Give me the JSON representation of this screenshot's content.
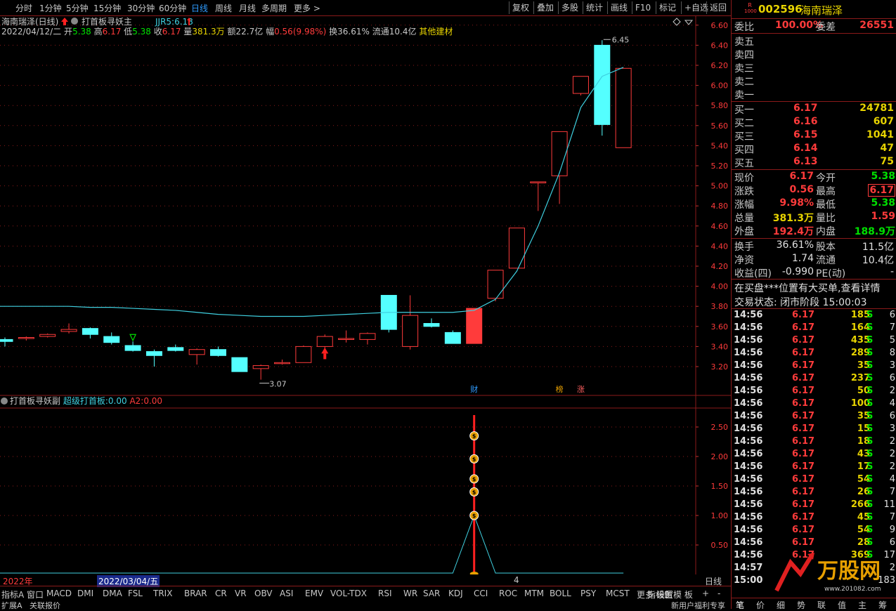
{
  "toolbar": {
    "periods": [
      "分时",
      "1分钟",
      "5分钟",
      "15分钟",
      "30分钟",
      "60分钟",
      "日线",
      "周线",
      "月线",
      "多周期",
      "更多 >"
    ],
    "active_period": "日线",
    "buttons": [
      "复权",
      "叠加",
      "多股",
      "统计",
      "画线",
      "F10",
      "标记",
      "+自选",
      "返回"
    ]
  },
  "info": {
    "title": "海南瑞泽(日线)",
    "indicator_main": "打首板寻妖主",
    "jjr_label": "JJR5:",
    "jjr_value": "6.18",
    "date": "2022/04/12/二",
    "open_label": "开",
    "open": "5.38",
    "high_label": "高",
    "high": "6.17",
    "low_label": "低",
    "low": "5.38",
    "close_label": "收",
    "close": "6.17",
    "volume_label": "量",
    "volume": "381.3万",
    "amount_label": "额",
    "amount": "22.7亿",
    "change_label": "幅",
    "change": "0.56(9.98%)",
    "turnover_label": "换",
    "turnover": "36.61%",
    "float_label": "流通",
    "float": "10.4亿",
    "sector": "其他建材"
  },
  "sub_panel": {
    "title": "打首板寻妖副",
    "s1_label": "超级打首板:",
    "s1_value": "0.00",
    "s2_label": "A2:",
    "s2_value": "0.00"
  },
  "annotations": {
    "high_mark": "6.45",
    "low_mark": "3.07",
    "tag_cai": "财",
    "tag_bang": "榜",
    "tag_zhang": "涨"
  },
  "timeaxis": {
    "year": "2022年",
    "cursor_date": "2022/03/04/五",
    "month4": "4",
    "daily_btn": "日线"
  },
  "bottom_tabs": [
    "指标A",
    "窗口",
    "MACD",
    "DMI",
    "DMA",
    "FSL",
    "TRIX",
    "BRAR",
    "CR",
    "VR",
    "OBV",
    "ASI",
    "EMV",
    "VOL-TDX",
    "RSI",
    "WR",
    "SAR",
    "KDJ",
    "CCI",
    "ROC",
    "MTM",
    "BOLL",
    "PSY",
    "MCST",
    "更多",
    "设置"
  ],
  "bottom_right": [
    "指标B",
    "模 板",
    "+",
    "-"
  ],
  "status": {
    "left1": "扩展A",
    "left2": "关联报价",
    "right": "新用户福利专享"
  },
  "quote": {
    "badge_top": "R",
    "badge_bottom": "1000",
    "code": "002596",
    "name": "海南瑞泽",
    "wb_label": "委比",
    "wb_value": "100.00%",
    "wc_label": "委差",
    "wc_value": "26551",
    "sells": [
      "卖五",
      "卖四",
      "卖三",
      "卖二",
      "卖一"
    ],
    "buys": [
      {
        "label": "买一",
        "price": "6.17",
        "vol": "24781"
      },
      {
        "label": "买二",
        "price": "6.16",
        "vol": "607"
      },
      {
        "label": "买三",
        "price": "6.15",
        "vol": "1041"
      },
      {
        "label": "买四",
        "price": "6.14",
        "vol": "47"
      },
      {
        "label": "买五",
        "price": "6.13",
        "vol": "75"
      }
    ],
    "stats": [
      {
        "l1": "现价",
        "v1": "6.17",
        "c1": "red",
        "l2": "今开",
        "v2": "5.38",
        "c2": "green"
      },
      {
        "l1": "涨跌",
        "v1": "0.56",
        "c1": "red",
        "l2": "最高",
        "v2": "6.17",
        "c2": "red"
      },
      {
        "l1": "涨幅",
        "v1": "9.98%",
        "c1": "red",
        "l2": "最低",
        "v2": "5.38",
        "c2": "green"
      },
      {
        "l1": "总量",
        "v1": "381.3万",
        "c1": "yellow",
        "l2": "量比",
        "v2": "1.59",
        "c2": "red"
      },
      {
        "l1": "外盘",
        "v1": "192.4万",
        "c1": "red",
        "l2": "内盘",
        "v2": "188.9万",
        "c2": "green"
      }
    ],
    "stats2": [
      {
        "l1": "换手",
        "v1": "36.61%",
        "l2": "股本",
        "v2": "11.5亿"
      },
      {
        "l1": "净资",
        "v1": "1.74",
        "l2": "流通",
        "v2": "10.4亿"
      },
      {
        "l1": "收益(四)",
        "v1": "-0.990",
        "l2": "PE(动)",
        "v2": "-"
      }
    ],
    "notice": "在买盘***位置有大买单,查看详情",
    "trade_state": "交易状态: 闭市阶段 15:00:03",
    "ticks": [
      {
        "t": "14:56",
        "p": "6.17",
        "v": "185",
        "s": "S",
        "n": "6"
      },
      {
        "t": "14:56",
        "p": "6.17",
        "v": "164",
        "s": "S",
        "n": "7"
      },
      {
        "t": "14:56",
        "p": "6.17",
        "v": "435",
        "s": "S",
        "n": "5"
      },
      {
        "t": "14:56",
        "p": "6.17",
        "v": "289",
        "s": "S",
        "n": "8"
      },
      {
        "t": "14:56",
        "p": "6.17",
        "v": "35",
        "s": "S",
        "n": "3"
      },
      {
        "t": "14:56",
        "p": "6.17",
        "v": "237",
        "s": "S",
        "n": "6"
      },
      {
        "t": "14:56",
        "p": "6.17",
        "v": "50",
        "s": "S",
        "n": "2"
      },
      {
        "t": "14:56",
        "p": "6.17",
        "v": "100",
        "s": "S",
        "n": "4"
      },
      {
        "t": "14:56",
        "p": "6.17",
        "v": "35",
        "s": "S",
        "n": "6"
      },
      {
        "t": "14:56",
        "p": "6.17",
        "v": "15",
        "s": "S",
        "n": "3"
      },
      {
        "t": "14:56",
        "p": "6.17",
        "v": "18",
        "s": "S",
        "n": "2"
      },
      {
        "t": "14:56",
        "p": "6.17",
        "v": "43",
        "s": "S",
        "n": "2"
      },
      {
        "t": "14:56",
        "p": "6.17",
        "v": "17",
        "s": "S",
        "n": "2"
      },
      {
        "t": "14:56",
        "p": "6.17",
        "v": "54",
        "s": "S",
        "n": "4"
      },
      {
        "t": "14:56",
        "p": "6.17",
        "v": "26",
        "s": "S",
        "n": "7"
      },
      {
        "t": "14:56",
        "p": "6.17",
        "v": "266",
        "s": "S",
        "n": "11"
      },
      {
        "t": "14:56",
        "p": "6.17",
        "v": "45",
        "s": "S",
        "n": "7"
      },
      {
        "t": "14:56",
        "p": "6.17",
        "v": "54",
        "s": "S",
        "n": "9"
      },
      {
        "t": "14:56",
        "p": "6.17",
        "v": "28",
        "s": "S",
        "n": "6"
      },
      {
        "t": "14:56",
        "p": "6.17",
        "v": "369",
        "s": "S",
        "n": "17"
      },
      {
        "t": "14:57",
        "p": "",
        "v": "",
        "s": "",
        "n": "2"
      },
      {
        "t": "15:00",
        "p": "",
        "v": "",
        "s": "",
        "n": "183"
      }
    ],
    "footer_tabs": [
      "笔",
      "价",
      "细",
      "势",
      "联",
      "值",
      "主",
      "筹"
    ],
    "watermark": "万股网",
    "watermark_url": "www.201082.com"
  },
  "colors": {
    "up": "#ff3b3b",
    "down": "#54ffff",
    "ma": "#3fd0e0",
    "grid": "#8b1a1a"
  },
  "chart_data": [
    {
      "type": "candlestick",
      "title": "海南瑞泽(日线)",
      "ylim": [
        3.07,
        6.6
      ],
      "yticks": [
        3.2,
        3.4,
        3.6,
        3.8,
        4.0,
        4.2,
        4.4,
        4.6,
        4.8,
        5.0,
        5.2,
        5.4,
        5.6,
        5.8,
        6.0,
        6.2,
        6.4,
        6.6
      ],
      "candles": [
        {
          "o": 3.47,
          "h": 3.49,
          "l": 3.4,
          "c": 3.45
        },
        {
          "o": 3.48,
          "h": 3.5,
          "l": 3.46,
          "c": 3.49
        },
        {
          "o": 3.5,
          "h": 3.53,
          "l": 3.49,
          "c": 3.52
        },
        {
          "o": 3.55,
          "h": 3.63,
          "l": 3.53,
          "c": 3.57
        },
        {
          "o": 3.58,
          "h": 3.59,
          "l": 3.48,
          "c": 3.52
        },
        {
          "o": 3.5,
          "h": 3.54,
          "l": 3.42,
          "c": 3.44
        },
        {
          "o": 3.41,
          "h": 3.45,
          "l": 3.35,
          "c": 3.36
        },
        {
          "o": 3.35,
          "h": 3.37,
          "l": 3.2,
          "c": 3.31
        },
        {
          "o": 3.39,
          "h": 3.42,
          "l": 3.35,
          "c": 3.36
        },
        {
          "o": 3.32,
          "h": 3.38,
          "l": 3.22,
          "c": 3.37
        },
        {
          "o": 3.37,
          "h": 3.4,
          "l": 3.3,
          "c": 3.31
        },
        {
          "o": 3.29,
          "h": 3.29,
          "l": 3.15,
          "c": 3.15
        },
        {
          "o": 3.18,
          "h": 3.22,
          "l": 3.07,
          "c": 3.21
        },
        {
          "o": 3.24,
          "h": 3.27,
          "l": 3.22,
          "c": 3.24
        },
        {
          "o": 3.24,
          "h": 3.41,
          "l": 3.24,
          "c": 3.4
        },
        {
          "o": 3.4,
          "h": 3.52,
          "l": 3.38,
          "c": 3.5
        },
        {
          "o": 3.47,
          "h": 3.56,
          "l": 3.44,
          "c": 3.48
        },
        {
          "o": 3.47,
          "h": 3.54,
          "l": 3.42,
          "c": 3.53
        },
        {
          "o": 3.91,
          "h": 3.91,
          "l": 3.54,
          "c": 3.57
        },
        {
          "o": 3.4,
          "h": 3.91,
          "l": 3.37,
          "c": 3.71
        },
        {
          "o": 3.63,
          "h": 3.68,
          "l": 3.59,
          "c": 3.6
        },
        {
          "o": 3.54,
          "h": 3.56,
          "l": 3.43,
          "c": 3.43
        },
        {
          "o": 3.43,
          "h": 3.78,
          "l": 3.43,
          "c": 3.78
        },
        {
          "o": 3.88,
          "h": 4.16,
          "l": 3.85,
          "c": 4.16
        },
        {
          "o": 4.18,
          "h": 4.58,
          "l": 4.18,
          "c": 4.58
        },
        {
          "o": 5.04,
          "h": 5.04,
          "l": 4.75,
          "c": 5.04
        },
        {
          "o": 5.1,
          "h": 5.54,
          "l": 4.82,
          "c": 5.54
        },
        {
          "o": 5.92,
          "h": 6.09,
          "l": 5.9,
          "c": 6.09
        },
        {
          "o": 6.4,
          "h": 6.45,
          "l": 5.5,
          "c": 5.61
        },
        {
          "o": 5.38,
          "h": 6.17,
          "l": 5.38,
          "c": 6.17
        }
      ],
      "ma": {
        "name": "JJR5",
        "values": [
          3.8,
          3.8,
          3.8,
          3.8,
          3.79,
          3.79,
          3.78,
          3.77,
          3.76,
          3.74,
          3.72,
          3.71,
          3.7,
          3.7,
          3.7,
          3.71,
          3.72,
          3.73,
          3.74,
          3.74,
          3.74,
          3.74,
          3.76,
          3.87,
          4.15,
          4.6,
          5.13,
          5.78,
          6.09,
          6.18
        ]
      }
    },
    {
      "type": "line",
      "title": "打首板寻妖副",
      "ylim": [
        0,
        2.75
      ],
      "yticks": [
        0.5,
        1.0,
        1.5,
        2.0,
        2.5
      ],
      "series": [
        {
          "name": "超级打首板",
          "values": [
            0,
            0,
            0,
            0,
            0,
            0,
            0,
            0,
            0,
            0,
            0,
            0,
            0,
            0,
            0,
            0,
            0,
            0,
            0,
            0,
            0,
            0,
            1.0,
            0,
            0,
            0,
            0,
            0,
            0,
            0
          ]
        }
      ],
      "signal_index": 22,
      "signal_markers": [
        1.0,
        1.4,
        1.62,
        1.96,
        2.35
      ]
    }
  ]
}
